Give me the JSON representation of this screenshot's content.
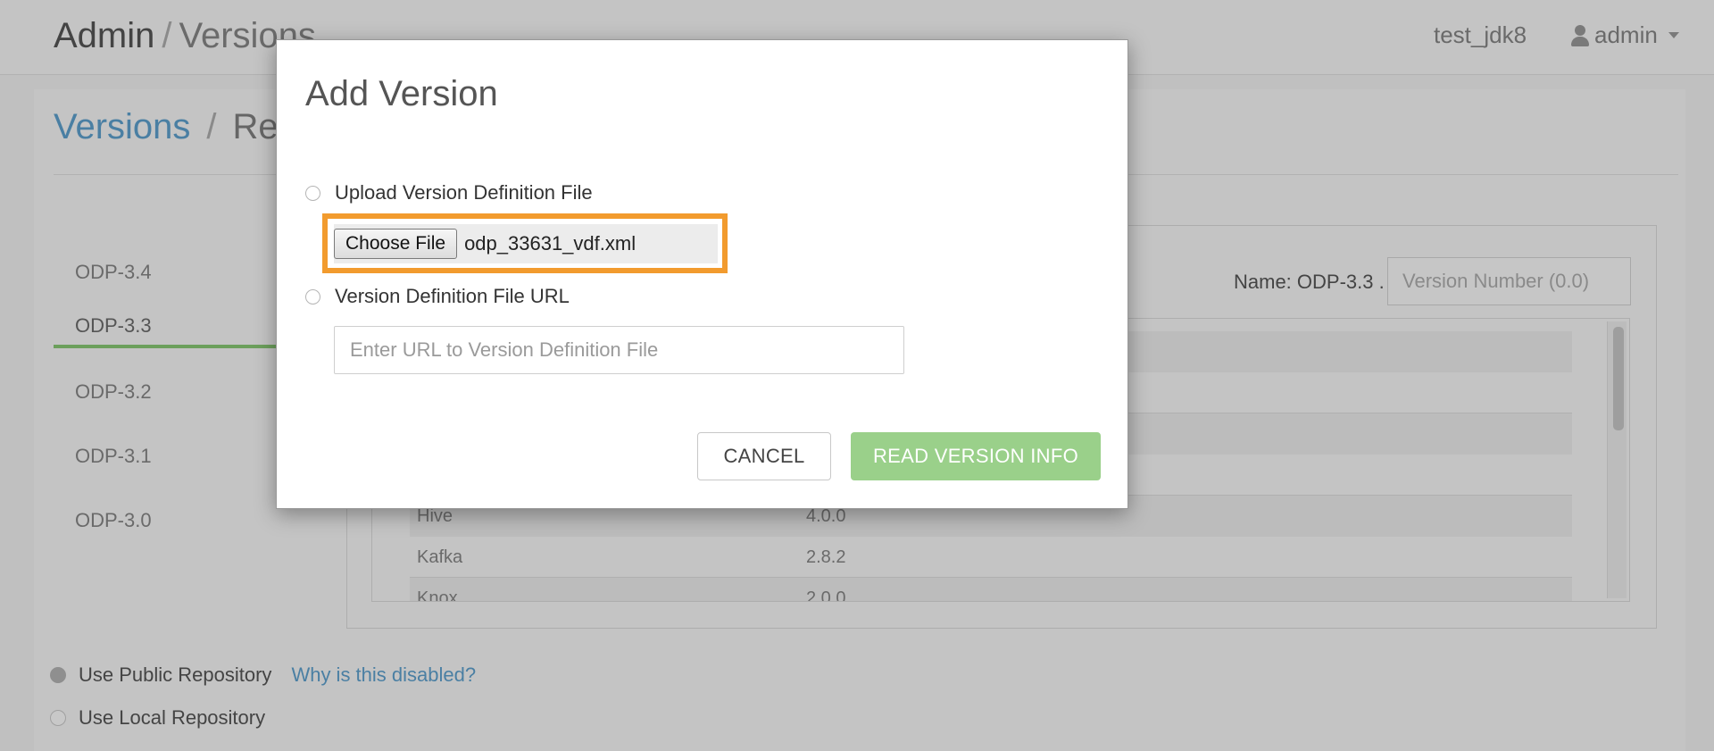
{
  "header": {
    "title_admin": "Admin",
    "title_sep": "/",
    "title_versions": "Versions",
    "cluster": "test_jdk8",
    "user": "admin"
  },
  "breadcrumb": {
    "link": "Versions",
    "sep": "/",
    "current": "Re"
  },
  "stacks": [
    {
      "label": "ODP-3.4",
      "active": false
    },
    {
      "label": "ODP-3.3",
      "active": true
    },
    {
      "label": "ODP-3.2",
      "active": false
    },
    {
      "label": "ODP-3.1",
      "active": false
    },
    {
      "label": "ODP-3.0",
      "active": false
    }
  ],
  "version_name": {
    "label": "Name: ODP-3.3 .",
    "placeholder": "Version Number (0.0)"
  },
  "components": [
    {
      "name": "Hive",
      "version": "4.0.0"
    },
    {
      "name": "Kafka",
      "version": "2.8.2"
    },
    {
      "name": "Knox",
      "version": "2.0.0"
    }
  ],
  "repository": {
    "public_label": "Use Public Repository",
    "disabled_link": "Why is this disabled?",
    "local_label": "Use Local Repository"
  },
  "modal": {
    "title": "Add Version",
    "upload_label": "Upload Version Definition File",
    "choose_file_label": "Choose File",
    "file_name": "odp_33631_vdf.xml",
    "url_label": "Version Definition File URL",
    "url_placeholder": "Enter URL to Version Definition File",
    "cancel_label": "CANCEL",
    "read_label": "READ VERSION INFO"
  },
  "colors": {
    "highlight": "#f29b2e",
    "primary_button": "#9ad08a",
    "link": "#4a7fa3",
    "active_tab_underline": "#6c9f5c"
  }
}
